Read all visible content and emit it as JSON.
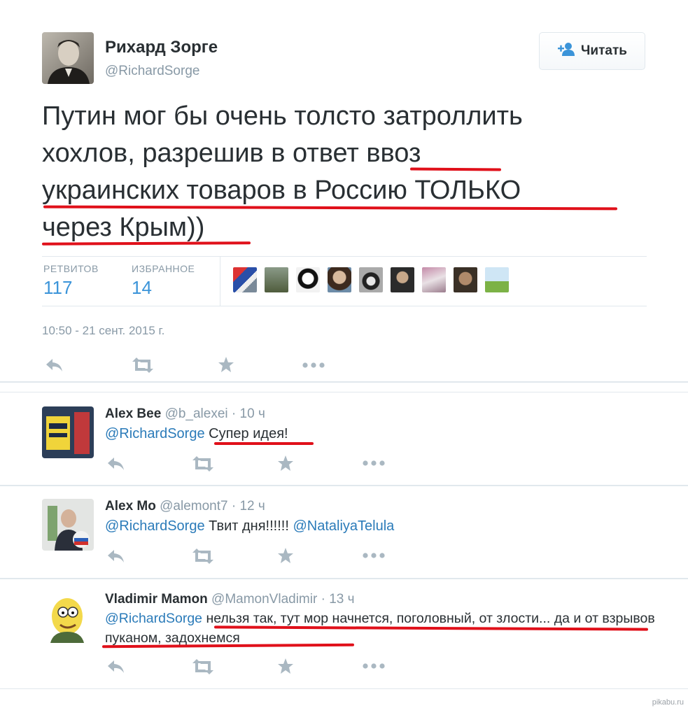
{
  "tweet": {
    "author_name": "Рихард Зорге",
    "author_handle": "@RichardSorge",
    "follow_label": "Читать",
    "text_lines": [
      "Путин мог бы очень толсто затроллить",
      "хохлов, разрешив в ответ ввоз",
      "украинских товаров в Россию ТОЛЬКО",
      "через Крым))"
    ],
    "retweets_label": "РЕТВИТОВ",
    "retweets_count": "117",
    "favorites_label": "ИЗБРАННОЕ",
    "favorites_count": "14",
    "timestamp": "10:50 - 21 сент. 2015 г."
  },
  "replies": [
    {
      "name": "Alex Bee",
      "handle": "@b_alexei",
      "dot": "·",
      "time": "10 ч",
      "mention": "@RichardSorge",
      "text": " Супер идея!"
    },
    {
      "name": "Alex Mo",
      "handle": "@alemont7",
      "dot": "·",
      "time": "12 ч",
      "mention": "@RichardSorge",
      "text": " Твит дня!!!!!! ",
      "mention2": "@NataliyaTelula"
    },
    {
      "name": "Vladimir Mamon",
      "handle": "@MamonVladimir",
      "dot": "·",
      "time": "13 ч",
      "mention": "@RichardSorge",
      "text": " нельзя так, тут мор начнется, поголовный, от злости... да и от взрывов пуканом, задохнемся"
    }
  ],
  "watermark": "pikabu.ru",
  "colors": {
    "link": "#2b7bb9",
    "stat": "#3b94d9",
    "muted": "#8899a6",
    "icon": "#aab8c2",
    "annotation_red": "#e0101a"
  },
  "icons": [
    "reply-icon",
    "retweet-icon",
    "favorite-icon",
    "more-icon",
    "follow-person-icon"
  ]
}
